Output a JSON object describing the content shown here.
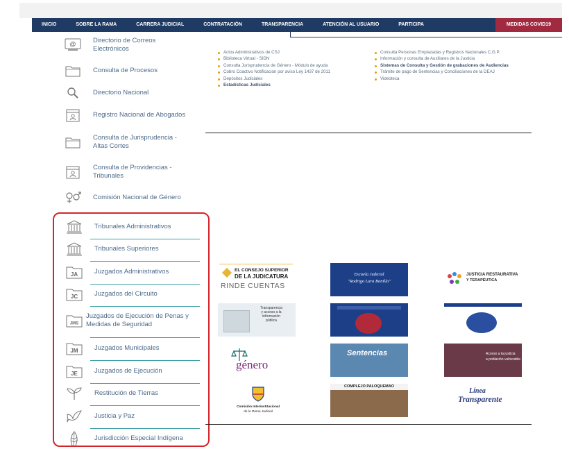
{
  "nav": {
    "items": [
      "INICIO",
      "SOBRE LA RAMA",
      "CARRERA JUDICIAL",
      "CONTRATACIÓN",
      "TRANSPARENCIA",
      "ATENCIÓN AL USUARIO",
      "PARTICIPA",
      "MEDIDAS COVID19"
    ]
  },
  "sidebar": {
    "items": [
      {
        "label": "Directorio de Correos Electrónicos",
        "icon": "email-at-icon"
      },
      {
        "label": "Consulta de Procesos",
        "icon": "folder-icon"
      },
      {
        "label": "Directorio Nacional",
        "icon": "search-icon"
      },
      {
        "label": "Registro Nacional de Abogados",
        "icon": "registry-icon"
      },
      {
        "label": "Consulta de Jurisprudencia - Altas Cortes",
        "icon": "folder-icon"
      },
      {
        "label": "Consulta de Providencias - Tribunales",
        "icon": "registry-icon"
      },
      {
        "label": "Comisión Nacional de Género",
        "icon": "gender-icon"
      }
    ]
  },
  "highlighted": {
    "items": [
      {
        "label": "Tribunales Administrativos",
        "icon": "courthouse-icon"
      },
      {
        "label": "Tribunales Superiores",
        "icon": "courthouse-icon"
      },
      {
        "label": "Juzgados Administrativos",
        "icon": "folder-ja-icon",
        "code": "JA"
      },
      {
        "label": "Juzgados del Circuito",
        "icon": "folder-jc-icon",
        "code": "JC"
      },
      {
        "label": "Juzgados de Ejecución de Penas y Medidas de Seguridad",
        "icon": "folder-jms-icon",
        "code": "JMS"
      },
      {
        "label": "Juzgados Municipales",
        "icon": "folder-jm-icon",
        "code": "JM"
      },
      {
        "label": "Juzgados de Ejecución",
        "icon": "folder-je-icon",
        "code": "JE"
      },
      {
        "label": "Restitución de Tierras",
        "icon": "sprout-icon"
      },
      {
        "label": "Justicia y Paz",
        "icon": "dove-icon"
      },
      {
        "label": "Jurisdicción Especial Indígena",
        "icon": "feather-icon"
      }
    ]
  },
  "links_left": [
    {
      "text": "Actos Administrativos de CSJ",
      "bold": false
    },
    {
      "text": "Biblioteca Virtual - SIDN",
      "bold": false
    },
    {
      "text": "Consulta Jurisprudencia de Género - Módulo de ayuda",
      "bold": false
    },
    {
      "text": "Cobro Coactivo Notificación por aviso Ley 1437 de 2011",
      "bold": false
    },
    {
      "text": "Depósitos Judiciales",
      "bold": false
    },
    {
      "text": "Estadísticas Judiciales",
      "bold": true
    }
  ],
  "links_right": [
    {
      "text": "Consulta Personas Emplazadas y Registros Nacionales C.G.P.",
      "bold": false
    },
    {
      "text": "Información y consulta de Auxiliares de la Justicia",
      "bold": false
    },
    {
      "text": "Sistemas de Consulta y Gestión de grabaciones de Audiencias",
      "bold": true
    },
    {
      "text": "Trámite de pago de Sentencias y Conciliaciones de la DEAJ",
      "bold": false
    },
    {
      "text": "Videoteca",
      "bold": false
    }
  ],
  "logos": {
    "rinde": {
      "line1": "EL CONSEJO SUPERIOR",
      "line2": "DE LA JUDICATURA",
      "line3": "RINDE CUENTAS"
    },
    "escuela": {
      "line1": "Escuela Judicial",
      "line2": "\"Rodrigo Lara Bonilla\""
    },
    "justicia_restaurativa": {
      "line1": "JUSTICIA RESTAURATIVA",
      "line2": "Y TERAPÉUTICA"
    },
    "transparencia": {
      "line1": "Transparencia",
      "line2": "y acceso a la",
      "line3": "información",
      "line4": "pública"
    },
    "genero": {
      "word": "género"
    },
    "sentencias": {
      "word": "Sentencias"
    },
    "acceso": {
      "line1": "Acceso a la justicia",
      "line2": "a población vulnerable"
    },
    "comision": {
      "line1": "Comisión Interinstitucional",
      "line2": "de la Rama Judicial"
    },
    "palo": {
      "word": "COMPLEJO PALOQUEMAO"
    },
    "linea": {
      "line1": "Línea",
      "line2": "Transparente"
    }
  },
  "colors": {
    "nav": "#1f3a63",
    "covid": "#a12a41",
    "highlight_border": "#d4242c",
    "separator": "#3b9ea8",
    "bullet": "#e1a100"
  }
}
